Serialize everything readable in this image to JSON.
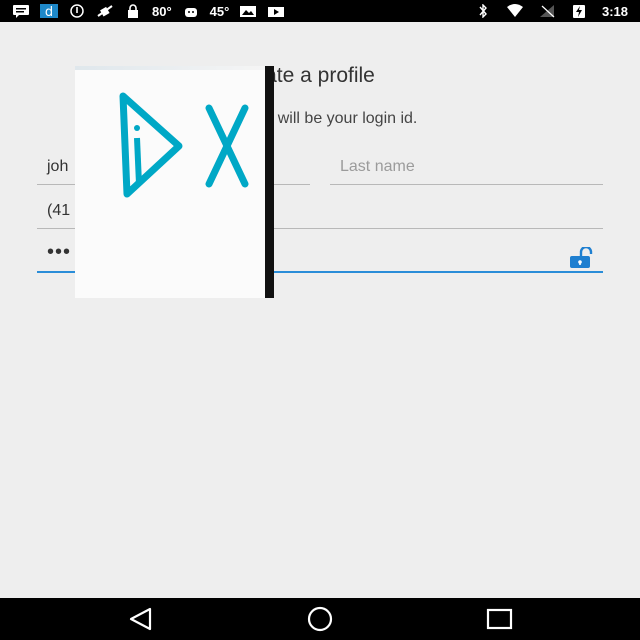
{
  "status_bar": {
    "temp1": "80°",
    "temp2": "45°",
    "time": "3:18",
    "left_icons": [
      "message-icon",
      "app-d-icon",
      "info-icon",
      "no-signal-icon",
      "lock-icon",
      "android-icon",
      "photo-icon",
      "video-icon"
    ],
    "right_icons": [
      "bluetooth-icon",
      "wifi-icon",
      "signal-off-icon",
      "battery-charging-icon"
    ]
  },
  "form": {
    "title": "ate a profile",
    "subtitle": "ail.com will be your login id.",
    "first_name_value": "joh",
    "last_name_placeholder": "Last name",
    "phone_value": "(41",
    "password_value": "•••"
  },
  "colors": {
    "accent": "#2a8dd8",
    "overlay_logo": "#00a8c6"
  },
  "nav_bar": {
    "buttons": [
      "back-icon",
      "home-icon",
      "recents-icon"
    ]
  }
}
